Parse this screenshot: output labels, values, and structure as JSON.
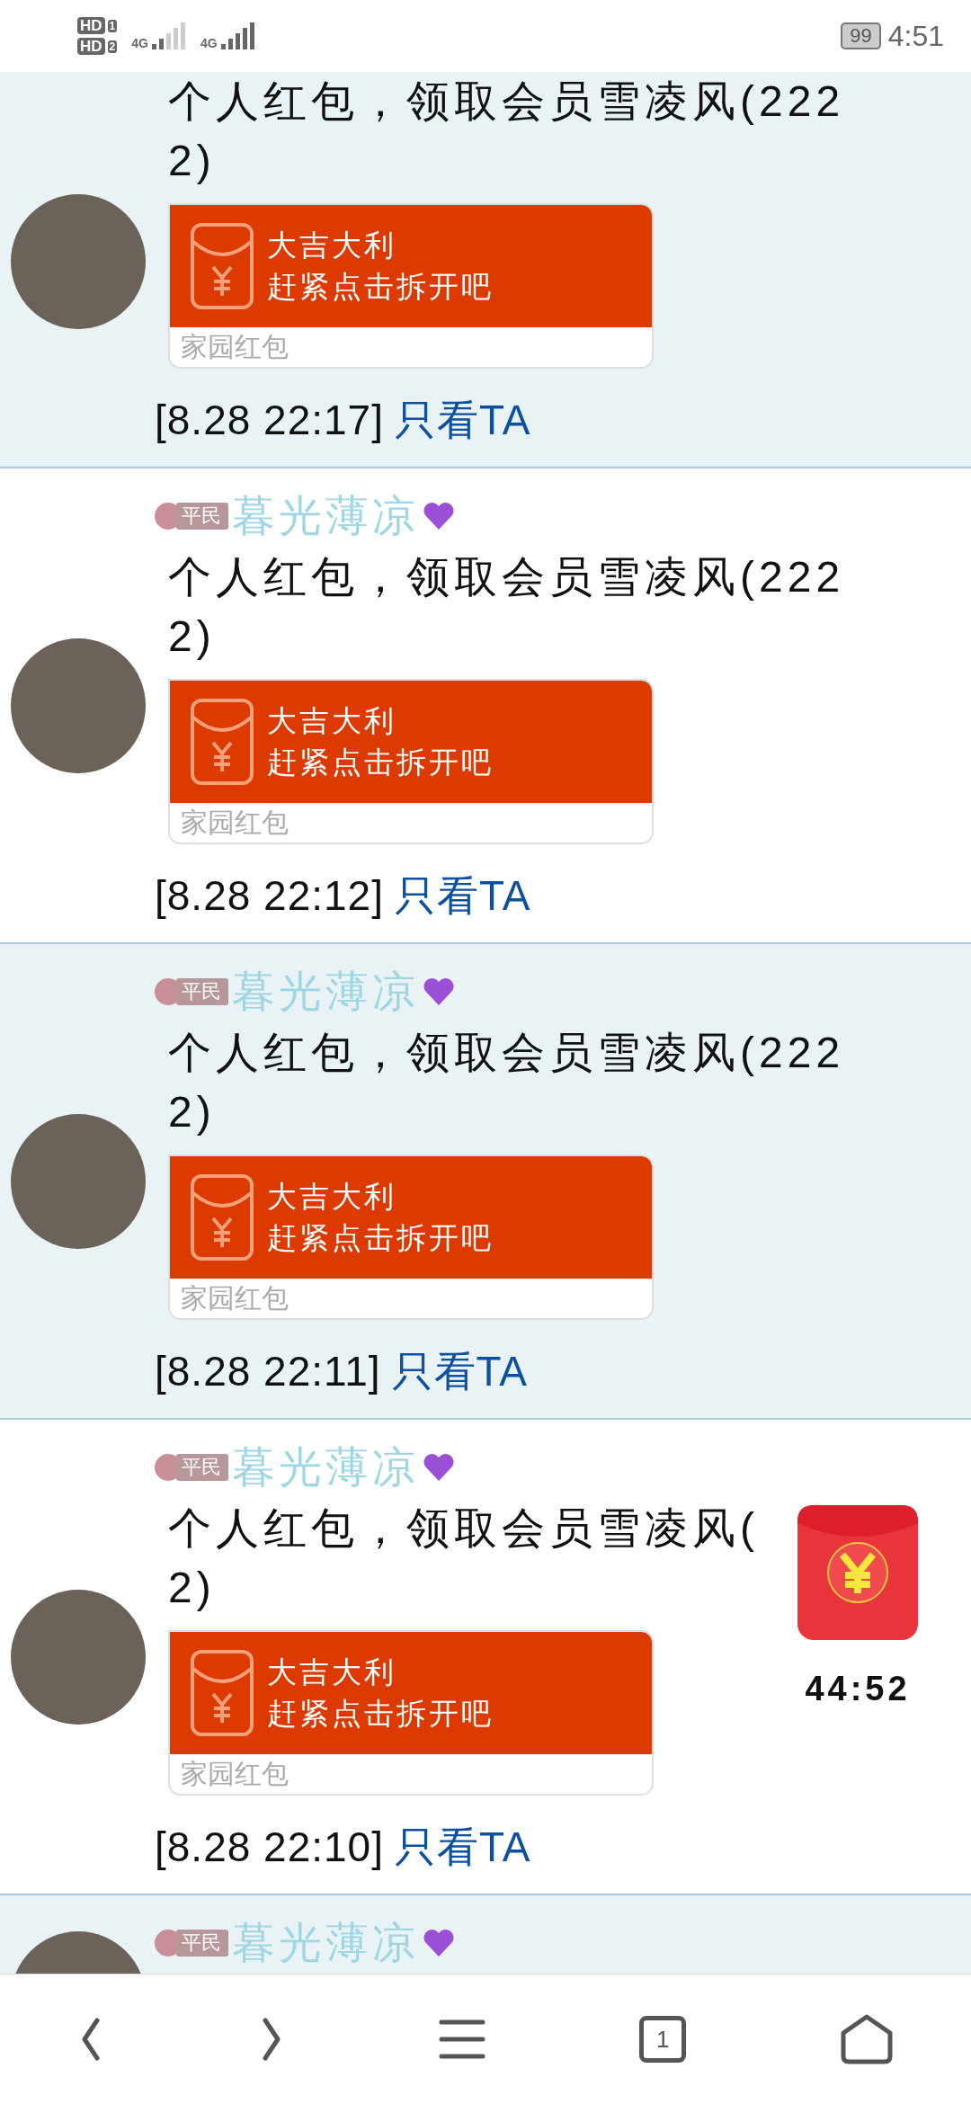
{
  "status_bar": {
    "sims": [
      {
        "label": "HD",
        "slot": "1"
      },
      {
        "label": "HD",
        "slot": "2"
      }
    ],
    "networks": [
      "4G",
      "4G"
    ],
    "battery": "99",
    "time": "4:51"
  },
  "posts": [
    {
      "text": [
        "个人红包，领取会员雪凌风(222",
        "2)"
      ],
      "packet": {
        "title": "大吉大利",
        "subtitle": "赶紧点击拆开吧",
        "footer": "家园红包"
      },
      "time": "[8.28 22:17]",
      "link": "只看TA"
    },
    {
      "rank": "平民",
      "name": "暮光薄凉",
      "text": [
        "个人红包，领取会员雪凌风(222",
        "2)"
      ],
      "packet": {
        "title": "大吉大利",
        "subtitle": "赶紧点击拆开吧",
        "footer": "家园红包"
      },
      "time": "[8.28 22:12]",
      "link": "只看TA"
    },
    {
      "rank": "平民",
      "name": "暮光薄凉",
      "text": [
        "个人红包，领取会员雪凌风(222",
        "2)"
      ],
      "packet": {
        "title": "大吉大利",
        "subtitle": "赶紧点击拆开吧",
        "footer": "家园红包"
      },
      "time": "[8.28 22:11]",
      "link": "只看TA"
    },
    {
      "rank": "平民",
      "name": "暮光薄凉",
      "text": [
        "个人红包，领取会员雪凌风(",
        "2)"
      ],
      "packet": {
        "title": "大吉大利",
        "subtitle": "赶紧点击拆开吧",
        "footer": "家园红包"
      },
      "time": "[8.28 22:10]",
      "link": "只看TA"
    },
    {
      "rank": "平民",
      "name": "暮光薄凉"
    }
  ],
  "floating_red_packet": {
    "timer": "44:52"
  },
  "bottom_nav": {
    "tab_count": "1"
  }
}
